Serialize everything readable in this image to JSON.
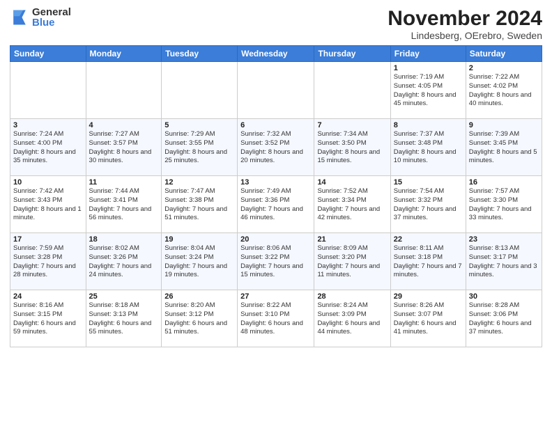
{
  "logo": {
    "general": "General",
    "blue": "Blue"
  },
  "title": "November 2024",
  "location": "Lindesberg, OErebro, Sweden",
  "days_of_week": [
    "Sunday",
    "Monday",
    "Tuesday",
    "Wednesday",
    "Thursday",
    "Friday",
    "Saturday"
  ],
  "weeks": [
    [
      {
        "day": "",
        "info": ""
      },
      {
        "day": "",
        "info": ""
      },
      {
        "day": "",
        "info": ""
      },
      {
        "day": "",
        "info": ""
      },
      {
        "day": "",
        "info": ""
      },
      {
        "day": "1",
        "info": "Sunrise: 7:19 AM\nSunset: 4:05 PM\nDaylight: 8 hours and 45 minutes."
      },
      {
        "day": "2",
        "info": "Sunrise: 7:22 AM\nSunset: 4:02 PM\nDaylight: 8 hours and 40 minutes."
      }
    ],
    [
      {
        "day": "3",
        "info": "Sunrise: 7:24 AM\nSunset: 4:00 PM\nDaylight: 8 hours and 35 minutes."
      },
      {
        "day": "4",
        "info": "Sunrise: 7:27 AM\nSunset: 3:57 PM\nDaylight: 8 hours and 30 minutes."
      },
      {
        "day": "5",
        "info": "Sunrise: 7:29 AM\nSunset: 3:55 PM\nDaylight: 8 hours and 25 minutes."
      },
      {
        "day": "6",
        "info": "Sunrise: 7:32 AM\nSunset: 3:52 PM\nDaylight: 8 hours and 20 minutes."
      },
      {
        "day": "7",
        "info": "Sunrise: 7:34 AM\nSunset: 3:50 PM\nDaylight: 8 hours and 15 minutes."
      },
      {
        "day": "8",
        "info": "Sunrise: 7:37 AM\nSunset: 3:48 PM\nDaylight: 8 hours and 10 minutes."
      },
      {
        "day": "9",
        "info": "Sunrise: 7:39 AM\nSunset: 3:45 PM\nDaylight: 8 hours and 5 minutes."
      }
    ],
    [
      {
        "day": "10",
        "info": "Sunrise: 7:42 AM\nSunset: 3:43 PM\nDaylight: 8 hours and 1 minute."
      },
      {
        "day": "11",
        "info": "Sunrise: 7:44 AM\nSunset: 3:41 PM\nDaylight: 7 hours and 56 minutes."
      },
      {
        "day": "12",
        "info": "Sunrise: 7:47 AM\nSunset: 3:38 PM\nDaylight: 7 hours and 51 minutes."
      },
      {
        "day": "13",
        "info": "Sunrise: 7:49 AM\nSunset: 3:36 PM\nDaylight: 7 hours and 46 minutes."
      },
      {
        "day": "14",
        "info": "Sunrise: 7:52 AM\nSunset: 3:34 PM\nDaylight: 7 hours and 42 minutes."
      },
      {
        "day": "15",
        "info": "Sunrise: 7:54 AM\nSunset: 3:32 PM\nDaylight: 7 hours and 37 minutes."
      },
      {
        "day": "16",
        "info": "Sunrise: 7:57 AM\nSunset: 3:30 PM\nDaylight: 7 hours and 33 minutes."
      }
    ],
    [
      {
        "day": "17",
        "info": "Sunrise: 7:59 AM\nSunset: 3:28 PM\nDaylight: 7 hours and 28 minutes."
      },
      {
        "day": "18",
        "info": "Sunrise: 8:02 AM\nSunset: 3:26 PM\nDaylight: 7 hours and 24 minutes."
      },
      {
        "day": "19",
        "info": "Sunrise: 8:04 AM\nSunset: 3:24 PM\nDaylight: 7 hours and 19 minutes."
      },
      {
        "day": "20",
        "info": "Sunrise: 8:06 AM\nSunset: 3:22 PM\nDaylight: 7 hours and 15 minutes."
      },
      {
        "day": "21",
        "info": "Sunrise: 8:09 AM\nSunset: 3:20 PM\nDaylight: 7 hours and 11 minutes."
      },
      {
        "day": "22",
        "info": "Sunrise: 8:11 AM\nSunset: 3:18 PM\nDaylight: 7 hours and 7 minutes."
      },
      {
        "day": "23",
        "info": "Sunrise: 8:13 AM\nSunset: 3:17 PM\nDaylight: 7 hours and 3 minutes."
      }
    ],
    [
      {
        "day": "24",
        "info": "Sunrise: 8:16 AM\nSunset: 3:15 PM\nDaylight: 6 hours and 59 minutes."
      },
      {
        "day": "25",
        "info": "Sunrise: 8:18 AM\nSunset: 3:13 PM\nDaylight: 6 hours and 55 minutes."
      },
      {
        "day": "26",
        "info": "Sunrise: 8:20 AM\nSunset: 3:12 PM\nDaylight: 6 hours and 51 minutes."
      },
      {
        "day": "27",
        "info": "Sunrise: 8:22 AM\nSunset: 3:10 PM\nDaylight: 6 hours and 48 minutes."
      },
      {
        "day": "28",
        "info": "Sunrise: 8:24 AM\nSunset: 3:09 PM\nDaylight: 6 hours and 44 minutes."
      },
      {
        "day": "29",
        "info": "Sunrise: 8:26 AM\nSunset: 3:07 PM\nDaylight: 6 hours and 41 minutes."
      },
      {
        "day": "30",
        "info": "Sunrise: 8:28 AM\nSunset: 3:06 PM\nDaylight: 6 hours and 37 minutes."
      }
    ]
  ]
}
